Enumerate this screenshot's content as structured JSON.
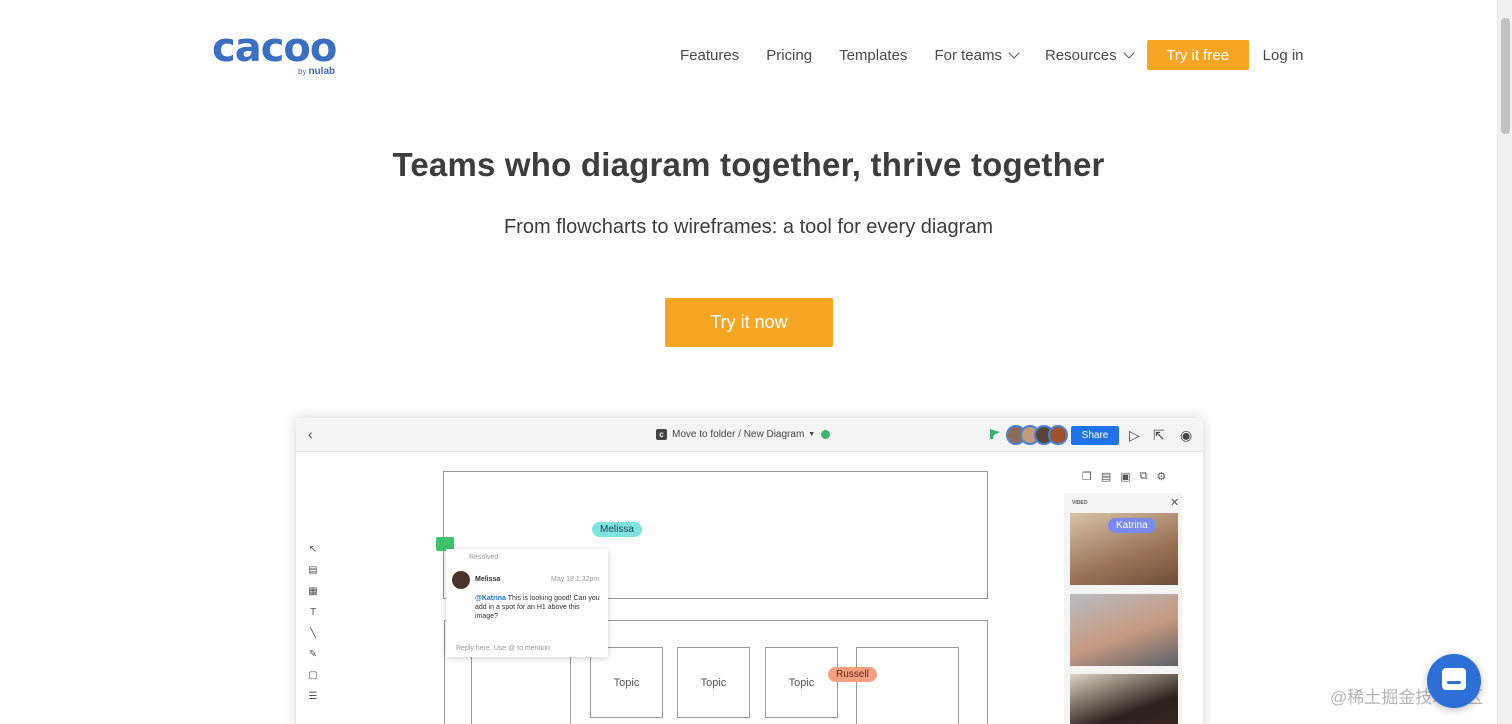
{
  "logo": {
    "wordmark": "cacoo",
    "byline_prefix": "by",
    "byline_brand": "nulab"
  },
  "nav": {
    "items": [
      {
        "label": "Features"
      },
      {
        "label": "Pricing"
      },
      {
        "label": "Templates"
      },
      {
        "label": "For teams"
      },
      {
        "label": "Resources"
      }
    ],
    "try_free_label": "Try it free",
    "login_label": "Log in"
  },
  "hero": {
    "title": "Teams who diagram together, thrive together",
    "subtitle": "From flowcharts to wireframes: a tool for every diagram",
    "cta_label": "Try it now"
  },
  "preview": {
    "back_glyph": "‹",
    "breadcrumb": "Move to folder / New Diagram",
    "share_label": "Share",
    "cursors": {
      "melissa": "Melissa",
      "russell": "Russell",
      "katrina": "Katrina"
    },
    "comment": {
      "status": "Resolved",
      "author": "Melissa",
      "date": "May 18 1:32pm",
      "mention": "@Katrina",
      "body": "This is looking good! Can you add in a spot for an H1 above this image?",
      "reply_placeholder": "Reply here. Use @ to mention"
    },
    "topics": [
      "Topic",
      "Topic",
      "Topic"
    ],
    "panel_label": "VIDEO"
  },
  "watermark": "@稀土掘金技术社区",
  "colors": {
    "accent": "#f6a623",
    "brand_blue": "#3b6fc4",
    "share_blue": "#1e73e8"
  }
}
